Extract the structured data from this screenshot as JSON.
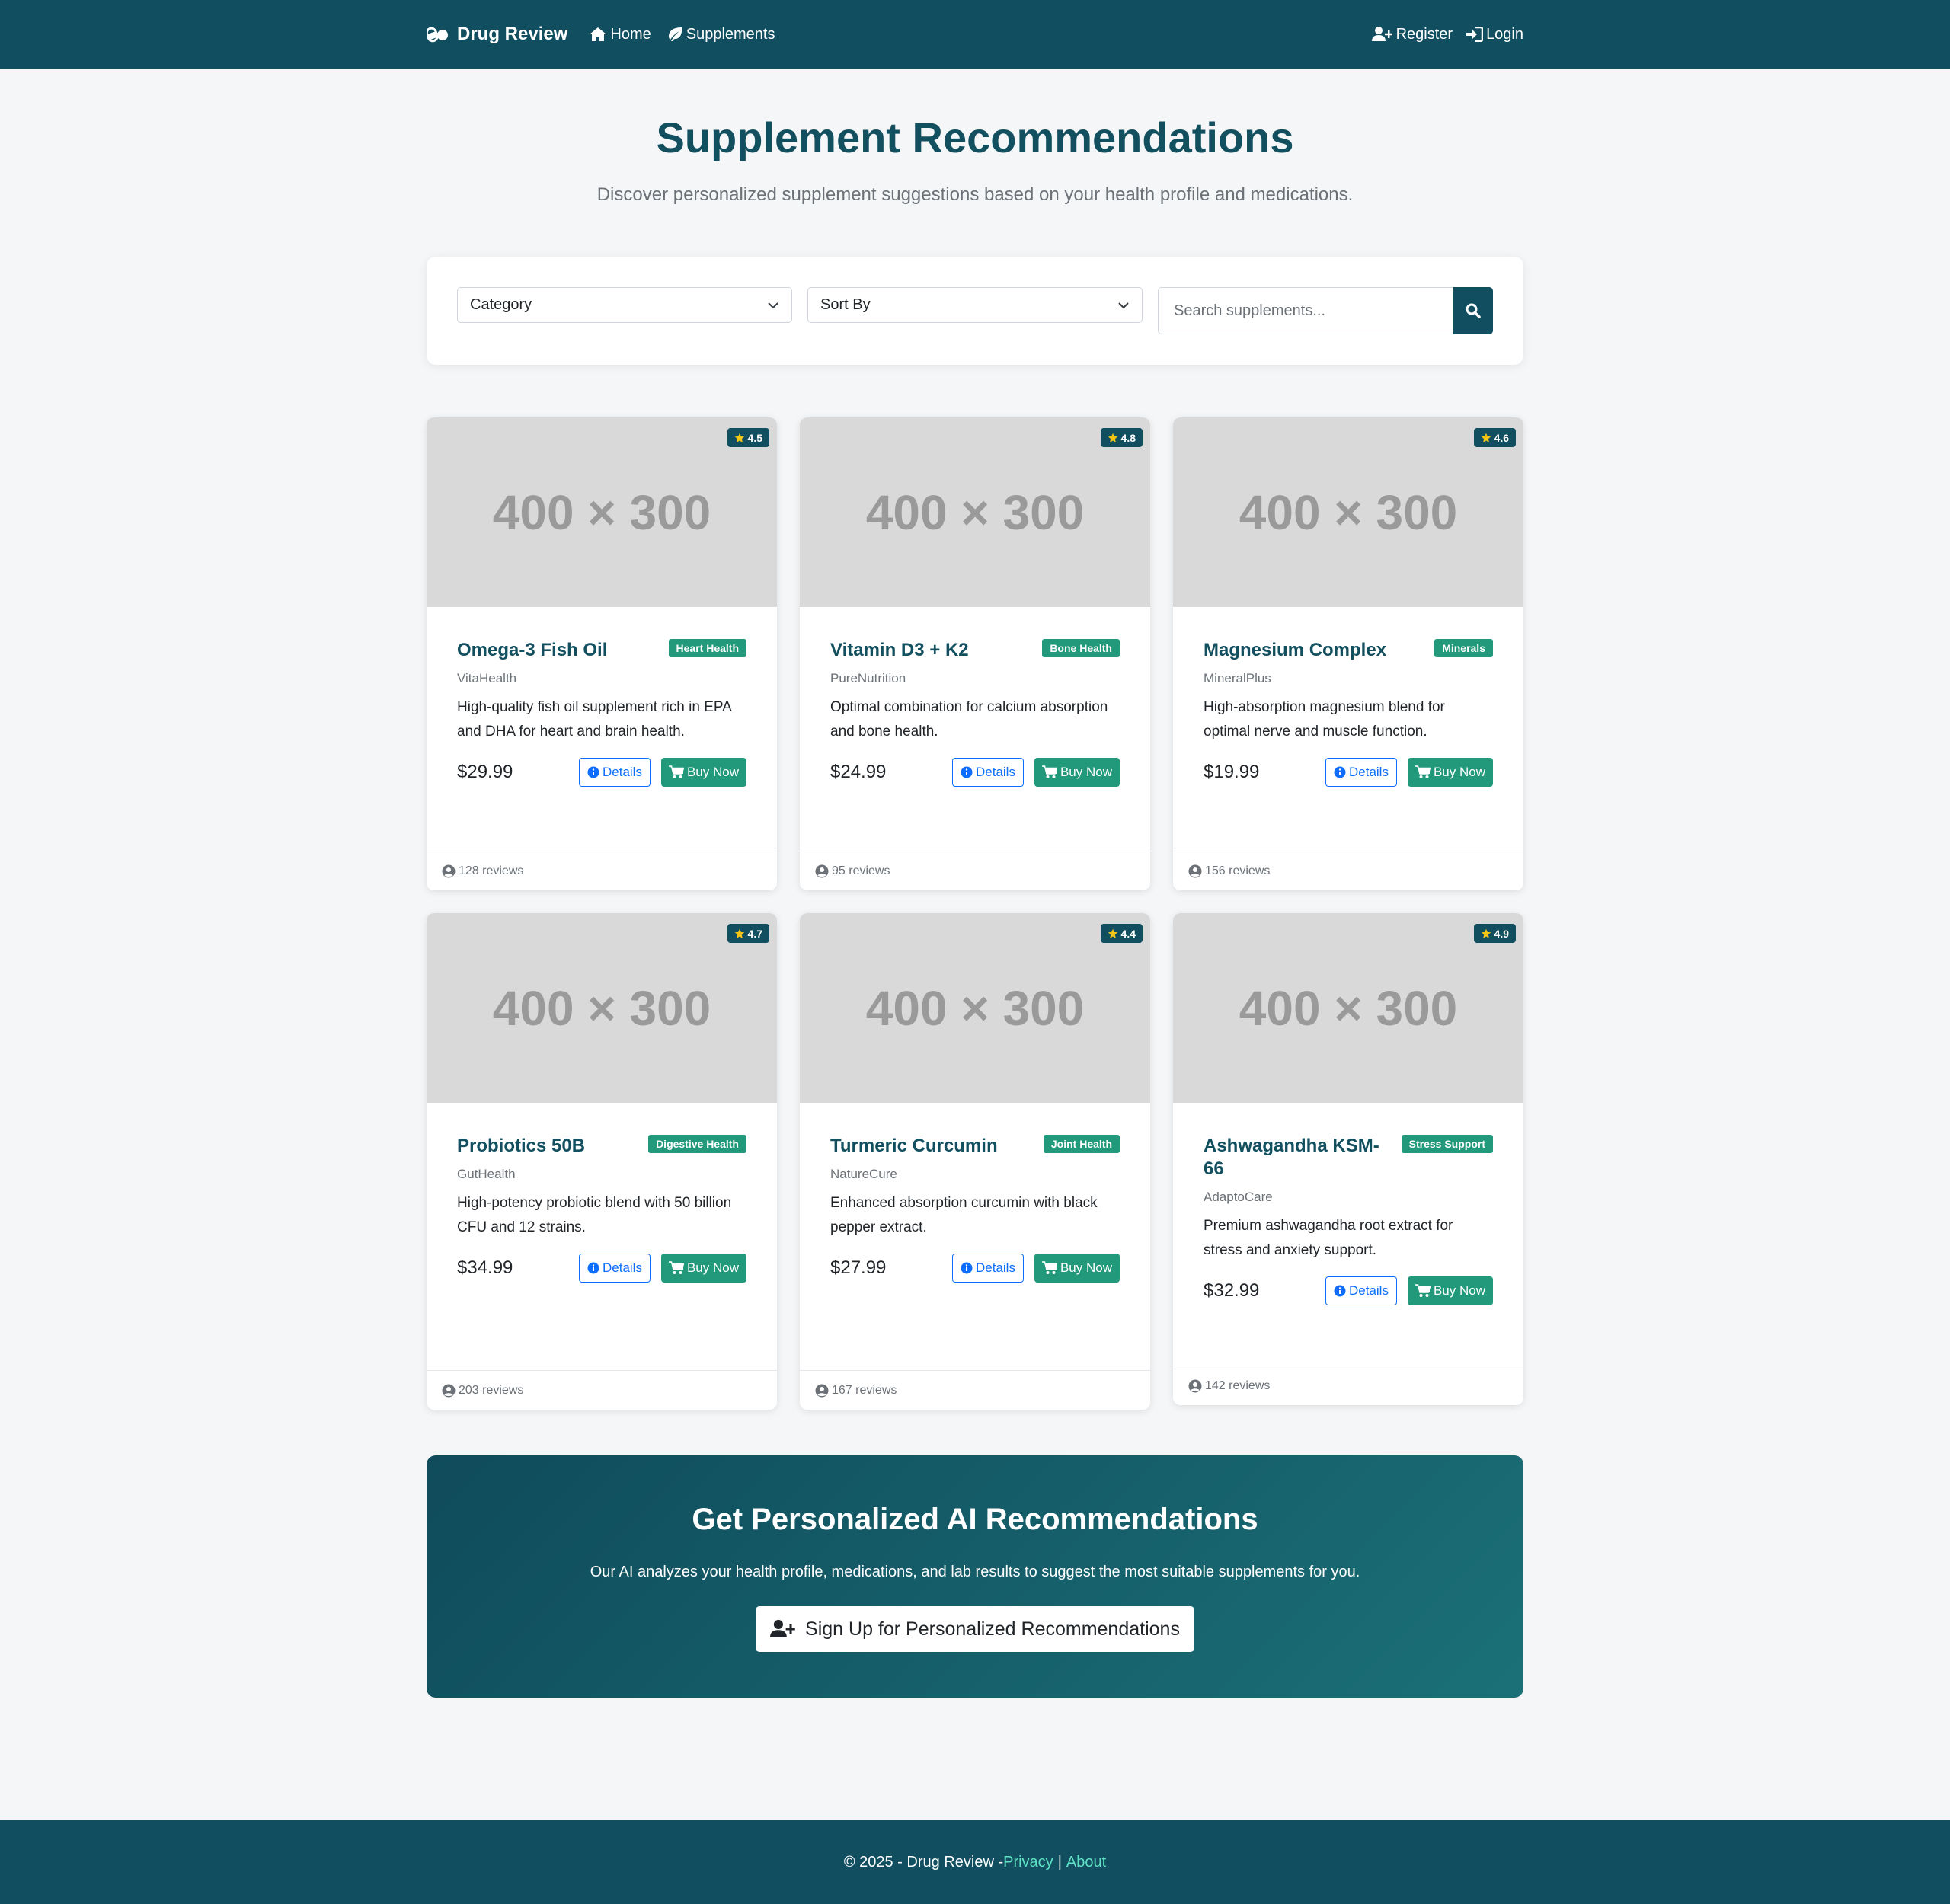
{
  "nav": {
    "brand": "Drug Review",
    "brand_icon": "pills-icon",
    "home": "Home",
    "supplements": "Supplements",
    "register": "Register",
    "login": "Login"
  },
  "hero": {
    "title": "Supplement Recommendations",
    "subtitle": "Discover personalized supplement suggestions based on your health profile and medications."
  },
  "filters": {
    "category": "Category",
    "sort_by": "Sort By",
    "search_placeholder": "Search supplements..."
  },
  "products": [
    {
      "image_text": "400 × 300",
      "rating": "4.5",
      "name": "Omega-3 Fish Oil",
      "category": "Heart Health",
      "brand": "VitaHealth",
      "description": "High-quality fish oil supplement rich in EPA and DHA for heart and brain health.",
      "price": "$29.99",
      "details": "Details",
      "buy": "Buy Now",
      "reviews": "128 reviews"
    },
    {
      "image_text": "400 × 300",
      "rating": "4.8",
      "name": "Vitamin D3 + K2",
      "category": "Bone Health",
      "brand": "PureNutrition",
      "description": "Optimal combination for calcium absorption and bone health.",
      "price": "$24.99",
      "details": "Details",
      "buy": "Buy Now",
      "reviews": "95 reviews"
    },
    {
      "image_text": "400 × 300",
      "rating": "4.6",
      "name": "Magnesium Complex",
      "category": "Minerals",
      "brand": "MineralPlus",
      "description": "High-absorption magnesium blend for optimal nerve and muscle function.",
      "price": "$19.99",
      "details": "Details",
      "buy": "Buy Now",
      "reviews": "156 reviews"
    },
    {
      "image_text": "400 × 300",
      "rating": "4.7",
      "name": "Probiotics 50B",
      "category": "Digestive Health",
      "brand": "GutHealth",
      "description": "High-potency probiotic blend with 50 billion CFU and 12 strains.",
      "price": "$34.99",
      "details": "Details",
      "buy": "Buy Now",
      "reviews": "203 reviews"
    },
    {
      "image_text": "400 × 300",
      "rating": "4.4",
      "name": "Turmeric Curcumin",
      "category": "Joint Health",
      "brand": "NatureCure",
      "description": "Enhanced absorption curcumin with black pepper extract.",
      "price": "$27.99",
      "details": "Details",
      "buy": "Buy Now",
      "reviews": "167 reviews"
    },
    {
      "image_text": "400 × 300",
      "rating": "4.9",
      "name": "Ashwagandha KSM-66",
      "category": "Stress Support",
      "brand": "AdaptoCare",
      "description": "Premium ashwagandha root extract for stress and anxiety support.",
      "price": "$32.99",
      "details": "Details",
      "buy": "Buy Now",
      "reviews": "142 reviews"
    }
  ],
  "cta": {
    "title": "Get Personalized AI Recommendations",
    "text": "Our AI analyzes your health profile, medications, and lab results to suggest the most suitable supplements for you.",
    "button": "Sign Up for Personalized Recommendations"
  },
  "footer": {
    "copyright": "© 2025 - Drug Review - ",
    "privacy": "Privacy",
    "separator": "|",
    "about": "About"
  },
  "colors": {
    "primary": "#114e5f",
    "accent": "#21997a",
    "link": "#0d6efd",
    "star": "#f5c518"
  }
}
